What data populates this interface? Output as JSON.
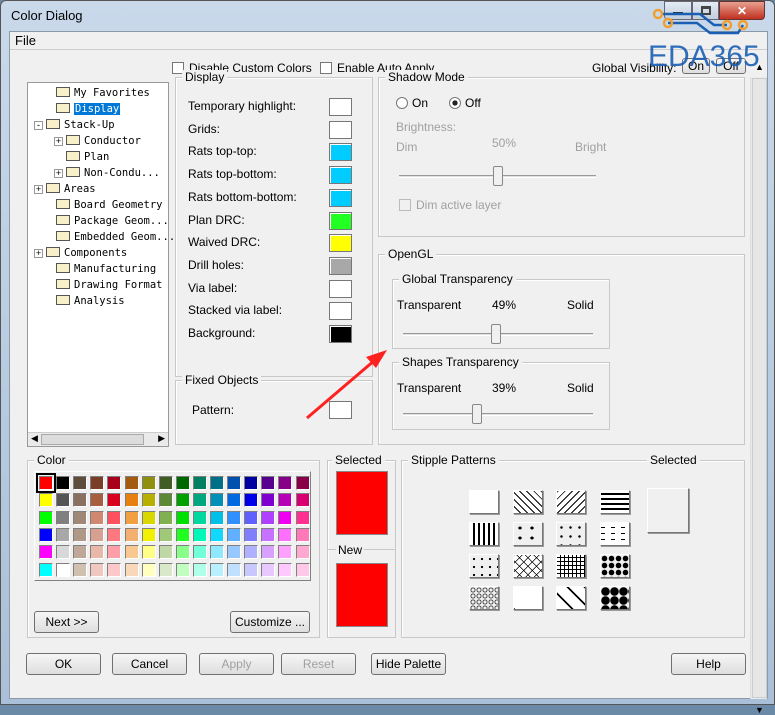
{
  "window": {
    "title": "Color Dialog"
  },
  "menu": {
    "file": "File"
  },
  "top": {
    "disable_custom": "Disable Custom Colors",
    "enable_auto_apply": "Enable Auto Apply",
    "global_visibility": "Global Visibility:",
    "on": "On",
    "off": "Off"
  },
  "tree": [
    {
      "label": "My Favorites",
      "indent": 1,
      "expander": false
    },
    {
      "label": "Display",
      "indent": 1,
      "expander": false,
      "selected": true
    },
    {
      "label": "Stack-Up",
      "indent": 0,
      "expander": "-"
    },
    {
      "label": "Conductor",
      "indent": 2,
      "expander": "+"
    },
    {
      "label": "Plan",
      "indent": 2,
      "expander": false
    },
    {
      "label": "Non-Condu...",
      "indent": 2,
      "expander": "+"
    },
    {
      "label": "Areas",
      "indent": 0,
      "expander": "+"
    },
    {
      "label": "Board Geometry",
      "indent": 1,
      "expander": false
    },
    {
      "label": "Package Geom...",
      "indent": 1,
      "expander": false
    },
    {
      "label": "Embedded Geom...",
      "indent": 1,
      "expander": false
    },
    {
      "label": "Components",
      "indent": 0,
      "expander": "+"
    },
    {
      "label": "Manufacturing",
      "indent": 1,
      "expander": false
    },
    {
      "label": "Drawing Format",
      "indent": 1,
      "expander": false
    },
    {
      "label": "Analysis",
      "indent": 1,
      "expander": false
    }
  ],
  "display": {
    "title": "Display",
    "items": [
      {
        "label": "Temporary highlight:",
        "color": "#ffffff"
      },
      {
        "label": "Grids:",
        "color": "#ffffff"
      },
      {
        "label": "Rats top-top:",
        "color": "#00ccff"
      },
      {
        "label": "Rats top-bottom:",
        "color": "#00ccff"
      },
      {
        "label": "Rats bottom-bottom:",
        "color": "#00ccff"
      },
      {
        "label": "Plan DRC:",
        "color": "#22ff22"
      },
      {
        "label": "Waived DRC:",
        "color": "#ffff00"
      },
      {
        "label": "Drill holes:",
        "color": "#a8a8a8"
      },
      {
        "label": "Via label:",
        "color": "#ffffff"
      },
      {
        "label": "Stacked via label:",
        "color": "#ffffff"
      },
      {
        "label": "Background:",
        "color": "#000000"
      }
    ]
  },
  "fixed": {
    "title": "Fixed Objects",
    "pattern": "Pattern:"
  },
  "shadow": {
    "title": "Shadow Mode",
    "on": "On",
    "off": "Off",
    "selected": "Off",
    "brightness": "Brightness:",
    "dim": "Dim",
    "pct": "50%",
    "bright": "Bright",
    "level": 50,
    "dim_active": "Dim active layer"
  },
  "opengl": {
    "title": "OpenGL",
    "global": {
      "title": "Global Transparency",
      "left": "Transparent",
      "pct": "49%",
      "right": "Solid",
      "level": 49
    },
    "shapes": {
      "title": "Shapes Transparency",
      "left": "Transparent",
      "pct": "39%",
      "right": "Solid",
      "level": 39
    }
  },
  "color": {
    "title": "Color",
    "selected_index": 0,
    "palette": [
      [
        "#ff0000",
        "#000000",
        "#5e4c3c",
        "#7a3e28",
        "#a8001a",
        "#a45a10",
        "#909010",
        "#425c26",
        "#006800",
        "#008060",
        "#007088",
        "#0050b0",
        "#0000a0",
        "#580090",
        "#880088",
        "#8a0048"
      ],
      [
        "#ffff00",
        "#555555",
        "#8a7060",
        "#a85c40",
        "#d8001c",
        "#e88010",
        "#b8b000",
        "#5c8838",
        "#00a000",
        "#00a880",
        "#0090b8",
        "#0068e0",
        "#0000e8",
        "#8000d0",
        "#b800b8",
        "#d80070"
      ],
      [
        "#00ff00",
        "#808080",
        "#a08878",
        "#d08870",
        "#ff5060",
        "#f0a040",
        "#d8d800",
        "#80b050",
        "#00e000",
        "#00d8a0",
        "#00c0e8",
        "#3090ff",
        "#6060ff",
        "#b040ff",
        "#f000f0",
        "#ff3090"
      ],
      [
        "#0000ff",
        "#a8a8a8",
        "#b09888",
        "#d8a090",
        "#ff7880",
        "#f4b070",
        "#f0f000",
        "#a0c878",
        "#20ff20",
        "#00f8b8",
        "#10d8ff",
        "#60b0ff",
        "#8080ff",
        "#c870ff",
        "#ff70ff",
        "#ff78b8"
      ],
      [
        "#ff00ff",
        "#d8d8d8",
        "#c0a898",
        "#e8b8a8",
        "#ffa0a8",
        "#f8c890",
        "#ffff88",
        "#c0d8a8",
        "#88ff88",
        "#70ffd8",
        "#90e8ff",
        "#98c8ff",
        "#b0b0ff",
        "#d8a0ff",
        "#ffa0ff",
        "#ffa8d0"
      ],
      [
        "#00ffff",
        "#ffffff",
        "#d0c0b0",
        "#f0c8c0",
        "#ffc8c8",
        "#f8d8b8",
        "#ffffc0",
        "#d8e8c8",
        "#c0ffc0",
        "#b0ffe8",
        "#b8f0ff",
        "#c0e0ff",
        "#c8c8ff",
        "#e8c8ff",
        "#ffc8ff",
        "#ffc8e8"
      ]
    ],
    "next": "Next >>",
    "customize": "Customize ..."
  },
  "selected": {
    "title": "Selected",
    "color": "#ff0000",
    "new_title": "New",
    "new_color": "#ff0000"
  },
  "stipple": {
    "title": "Stipple Patterns",
    "selected": "Selected",
    "patterns": [
      "blank",
      "diag-back",
      "diag-fwd",
      "horizontal",
      "vertical",
      "triangles",
      "crosses",
      "dashes",
      "dots",
      "crosshatch-diag",
      "grid",
      "plus-dots",
      "circles",
      "octagon",
      "diamond-x",
      "diamond-fill"
    ]
  },
  "buttons": {
    "ok": "OK",
    "cancel": "Cancel",
    "apply": "Apply",
    "reset": "Reset",
    "hide_palette": "Hide Palette",
    "help": "Help"
  },
  "watermark": "EDA365",
  "annotation": {
    "arrow_color": "#ff2020"
  }
}
